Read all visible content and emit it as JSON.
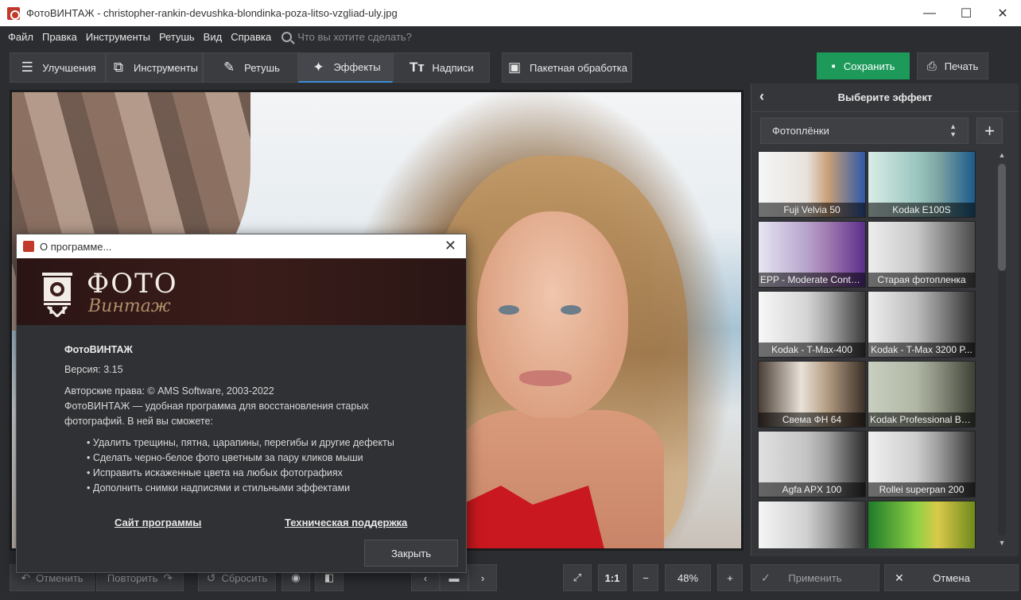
{
  "window": {
    "title": "ФотоВИНТАЖ - christopher-rankin-devushka-blondinka-poza-litso-vzgliad-uly.jpg",
    "minimize": "—",
    "maximize": "☐",
    "close": "✕"
  },
  "menu": {
    "items": [
      "Файл",
      "Правка",
      "Инструменты",
      "Ретушь",
      "Вид",
      "Справка"
    ],
    "search_placeholder": "Что вы хотите сделать?"
  },
  "toolbar": {
    "tabs": [
      {
        "label": "Улучшения",
        "icon": "sliders-icon",
        "active": false
      },
      {
        "label": "Инструменты",
        "icon": "crop-icon",
        "active": false
      },
      {
        "label": "Ретушь",
        "icon": "brush-icon",
        "active": false
      },
      {
        "label": "Эффекты",
        "icon": "magic-wand-icon",
        "active": true
      },
      {
        "label": "Надписи",
        "icon": "text-icon",
        "active": false
      }
    ],
    "batch_label": "Пакетная обработка",
    "save_label": "Сохранить",
    "print_label": "Печать",
    "save_color": "#1d9a5a"
  },
  "effects_panel": {
    "title": "Выберите эффект",
    "category": "Фотоплёнки",
    "add": "+",
    "effects": [
      {
        "label": "Fuji Velvia 50",
        "tone": "color"
      },
      {
        "label": "Kodak E100S",
        "tone": "teal"
      },
      {
        "label": "EPP - Moderate Conta...",
        "tone": "purple"
      },
      {
        "label": "Старая фотопленка",
        "tone": "gray"
      },
      {
        "label": "Kodak - T-Max-400",
        "tone": "bw"
      },
      {
        "label": "Kodak - T-Max 3200 P...",
        "tone": "bw"
      },
      {
        "label": "Свема ФН 64",
        "tone": "sepia"
      },
      {
        "label": "Kodak Professional BW...",
        "tone": "greenish"
      },
      {
        "label": "Agfa APX 100",
        "tone": "bw"
      },
      {
        "label": "Rollei superpan 200",
        "tone": "bw"
      },
      {
        "label": "",
        "tone": "bw"
      },
      {
        "label": "",
        "tone": "lime"
      }
    ]
  },
  "bottom": {
    "undo": "Отменить",
    "redo": "Повторить",
    "reset": "Сбросить",
    "ratio": "1:1",
    "zoom": "48%",
    "minus": "−",
    "plus": "+",
    "apply": "Применить",
    "cancel": "Отмена"
  },
  "about_dialog": {
    "title": "О программе...",
    "logo_main": "ФОТО",
    "logo_sub": "Винтаж",
    "product_name": "ФотоВИНТАЖ",
    "version": "Версия: 3.15",
    "copyright": "Авторские права: © AMS Software, 2003-2022",
    "description": "ФотоВИНТАЖ — удобная программа для восстановления старых фотографий. В ней вы сможете:",
    "features": [
      "Удалить трещины, пятна, царапины, перегибы и другие дефекты",
      "Сделать черно-белое фото цветным за пару кликов мыши",
      "Исправить искаженные цвета на любых фотографиях",
      "Дополнить снимки надписями и стильными эффектами"
    ],
    "site_link": "Сайт программы",
    "support_link": "Техническая поддержка",
    "close_button": "Закрыть"
  }
}
